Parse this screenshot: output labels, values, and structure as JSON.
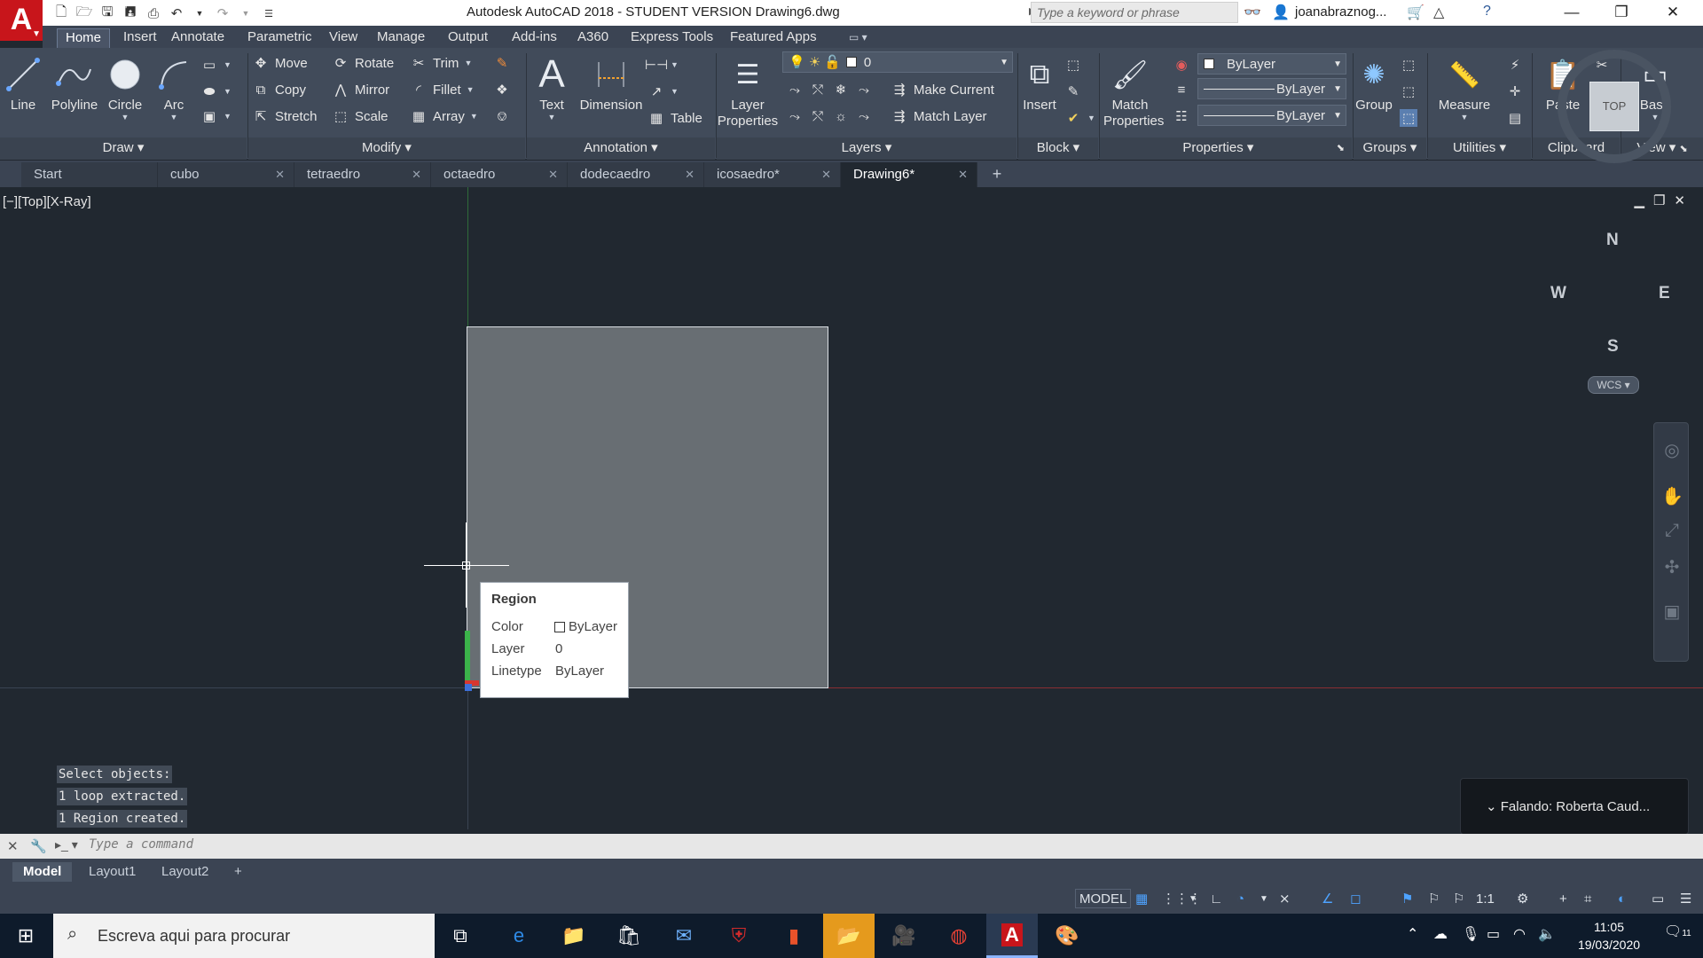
{
  "window": {
    "title": "Autodesk AutoCAD 2018 - STUDENT VERSION    Drawing6.dwg",
    "search_placeholder": "Type a keyword or phrase",
    "user": "joanabraznog..."
  },
  "ribbon_tabs": [
    "Home",
    "Insert",
    "Annotate",
    "Parametric",
    "View",
    "Manage",
    "Output",
    "Add-ins",
    "A360",
    "Express Tools",
    "Featured Apps"
  ],
  "ribbon": {
    "draw": {
      "title": "Draw",
      "line": "Line",
      "polyline": "Polyline",
      "circle": "Circle",
      "arc": "Arc"
    },
    "modify": {
      "title": "Modify",
      "move": "Move",
      "rotate": "Rotate",
      "trim": "Trim",
      "copy": "Copy",
      "mirror": "Mirror",
      "fillet": "Fillet",
      "stretch": "Stretch",
      "scale": "Scale",
      "array": "Array"
    },
    "annotation": {
      "title": "Annotation",
      "text": "Text",
      "dimension": "Dimension",
      "table": "Table"
    },
    "layers": {
      "title": "Layers",
      "layer_properties": "Layer Properties",
      "current_layer": "0",
      "make_current": "Make Current",
      "match_layer": "Match Layer"
    },
    "block": {
      "title": "Block",
      "insert": "Insert"
    },
    "properties": {
      "title": "Properties",
      "match_properties": "Match Properties",
      "color": "ByLayer",
      "lineweight": "ByLayer",
      "linetype": "ByLayer"
    },
    "groups": {
      "title": "Groups",
      "group": "Group"
    },
    "utilities": {
      "title": "Utilities",
      "measure": "Measure"
    },
    "clipboard": {
      "title": "Clipboard",
      "paste": "Paste"
    },
    "view": {
      "title": "View",
      "base": "Base"
    }
  },
  "doc_tabs": [
    "Start",
    "cubo",
    "tetraedro",
    "octaedro",
    "dodecaedro",
    "icosaedro*",
    "Drawing6*"
  ],
  "viewport": {
    "label": "[−][Top][X-Ray]",
    "viewcube": {
      "top": "TOP",
      "n": "N",
      "s": "S",
      "e": "E",
      "w": "W",
      "wcs": "WCS"
    }
  },
  "tooltip": {
    "title": "Region",
    "rows": [
      {
        "key": "Color",
        "value": "ByLayer"
      },
      {
        "key": "Layer",
        "value": "0"
      },
      {
        "key": "Linetype",
        "value": "ByLayer"
      }
    ]
  },
  "command_history": [
    "Select objects:",
    "1 loop extracted.",
    "1 Region created."
  ],
  "command_placeholder": "Type a command",
  "notification": "Falando:  Roberta  Caud...",
  "layout_tabs": [
    "Model",
    "Layout1",
    "Layout2"
  ],
  "status": {
    "space": "MODEL",
    "scale": "1:1"
  },
  "taskbar": {
    "search": "Escreva aqui para procurar",
    "time": "11:05",
    "date": "19/03/2020",
    "notifications": "11"
  },
  "colors": {
    "accent_red": "#c8151b",
    "region_fill": "#686e73",
    "canvas": "#212830",
    "ribbon": "#414b5a"
  }
}
